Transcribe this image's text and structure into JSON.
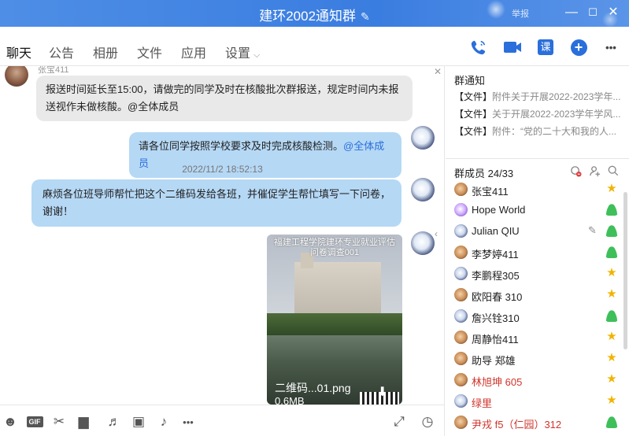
{
  "window": {
    "title": "建环2002通知群",
    "report": "举报",
    "edit_glyph": "✎",
    "min_glyph": "—",
    "max_glyph": "☐",
    "close_glyph": "✕"
  },
  "tabs": [
    {
      "label": "聊天"
    },
    {
      "label": "公告"
    },
    {
      "label": "相册"
    },
    {
      "label": "文件"
    },
    {
      "label": "应用"
    },
    {
      "label": "设置"
    }
  ],
  "top_actions": {
    "course_label": "课",
    "plus_label": "+",
    "more_label": "•••"
  },
  "chat": {
    "messages": [
      {
        "sender": "张宝411",
        "text": "报送时间延长至15:00，请做完的同学及时在核酸批次群报送，规定时间内未报送视作未做核酸。@全体成员",
        "side": "left"
      },
      {
        "text": "请各位同学按照学校要求及时完成核酸检测。",
        "mention": "@全体成员",
        "side": "right"
      },
      {
        "timestamp": "2022/11/2 18:52:13"
      },
      {
        "text": "麻烦各位班导师帮忙把这个二维码发给各班，并催促学生帮忙填写一下问卷，谢谢！",
        "side": "right"
      }
    ],
    "image_card": {
      "caption": "福建工程学院建环专业就业评估问卷调查001",
      "filename": "二维码...01.png",
      "size": "0.6MB",
      "download_glyph": "⬇"
    },
    "close_glyph": "✕",
    "expand_glyph": "‹"
  },
  "toolbar": {
    "emoji": "☻",
    "gif": "GIF",
    "scissors": "✂",
    "folder": "▆",
    "shake": "♬",
    "image": "▣",
    "bell": "♪",
    "more": "•••",
    "expand": "⤢",
    "history": "◷"
  },
  "right": {
    "notice_title": "群通知",
    "notices": [
      {
        "tag": "【文件】",
        "text": "附件关于开展2022-2023学年..."
      },
      {
        "tag": "【文件】",
        "text": "关于开展2022-2023学年学风..."
      },
      {
        "tag": "【文件】",
        "text": "附件：“党的二十大和我的人..."
      }
    ],
    "members_title": "群成员 24/33",
    "members": [
      {
        "name": "张宝411",
        "role": "star"
      },
      {
        "name": "Hope World",
        "role": "person"
      },
      {
        "name": "Julian QIU",
        "role": "person"
      },
      {
        "name": "李梦婷411",
        "role": "person"
      },
      {
        "name": "李鹏程305",
        "role": "star"
      },
      {
        "name": "欧阳春 310",
        "role": "star"
      },
      {
        "name": "詹兴铨310",
        "role": "person"
      },
      {
        "name": "周静怡411",
        "role": "star"
      },
      {
        "name": "助导 郑雄",
        "role": "star"
      },
      {
        "name": "林旭坤 605",
        "role": "star"
      },
      {
        "name": "绿里",
        "role": "star"
      },
      {
        "name": "尹戎 f5（仁园）312",
        "role": "person"
      }
    ]
  }
}
